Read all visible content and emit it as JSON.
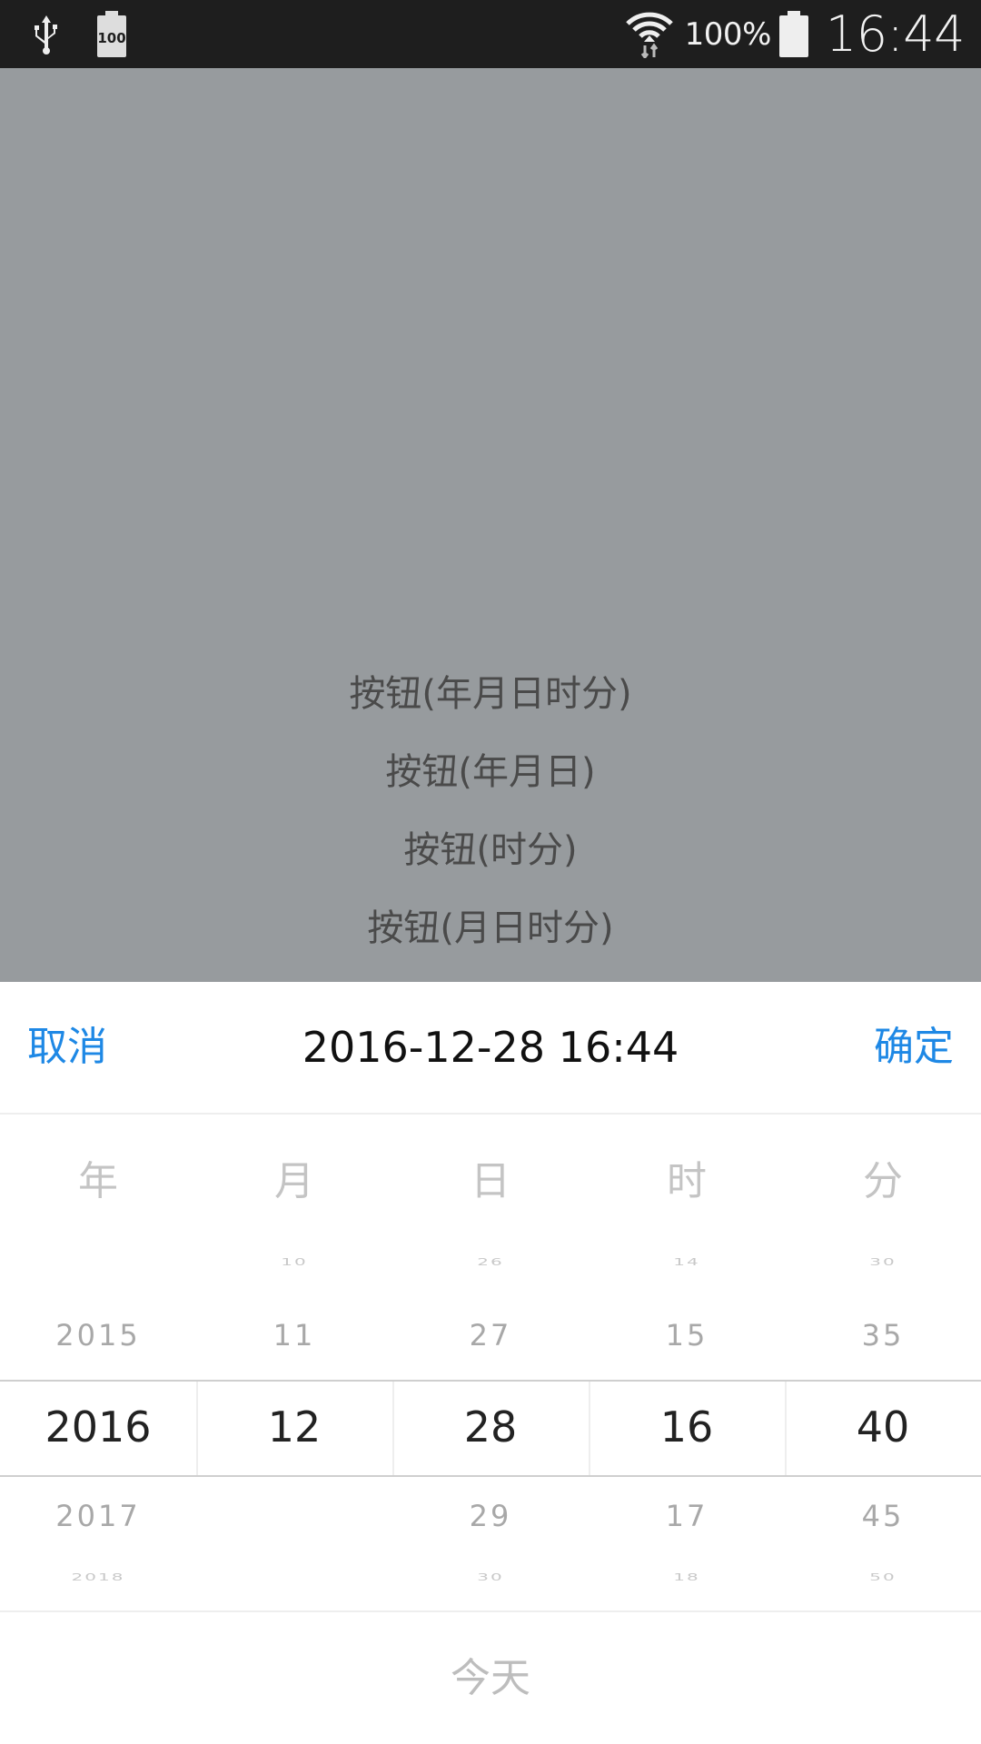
{
  "status_bar": {
    "icons": [
      "usb-icon",
      "battery-100-icon",
      "wifi-icon",
      "battery-icon"
    ],
    "battery_small_label": "100",
    "battery_percent": "100%",
    "time": "16:44"
  },
  "main": {
    "buttons": [
      {
        "label": "按钮(年月日时分)"
      },
      {
        "label": "按钮(年月日)"
      },
      {
        "label": "按钮(时分)"
      },
      {
        "label": "按钮(月日时分)"
      }
    ]
  },
  "picker": {
    "cancel_label": "取消",
    "title": "2016-12-28 16:44",
    "confirm_label": "确定",
    "columns": [
      {
        "header": "年",
        "items": [
          "",
          "2015",
          "2016",
          "2017",
          "2018"
        ]
      },
      {
        "header": "月",
        "items": [
          "10",
          "11",
          "12",
          "",
          ""
        ]
      },
      {
        "header": "日",
        "items": [
          "26",
          "27",
          "28",
          "29",
          "30"
        ]
      },
      {
        "header": "时",
        "items": [
          "14",
          "15",
          "16",
          "17",
          "18"
        ]
      },
      {
        "header": "分",
        "items": [
          "30",
          "35",
          "40",
          "45",
          "50"
        ]
      }
    ],
    "today_label": "今天",
    "colors": {
      "accent": "#1e88e5",
      "overlay": "#979b9e"
    }
  }
}
